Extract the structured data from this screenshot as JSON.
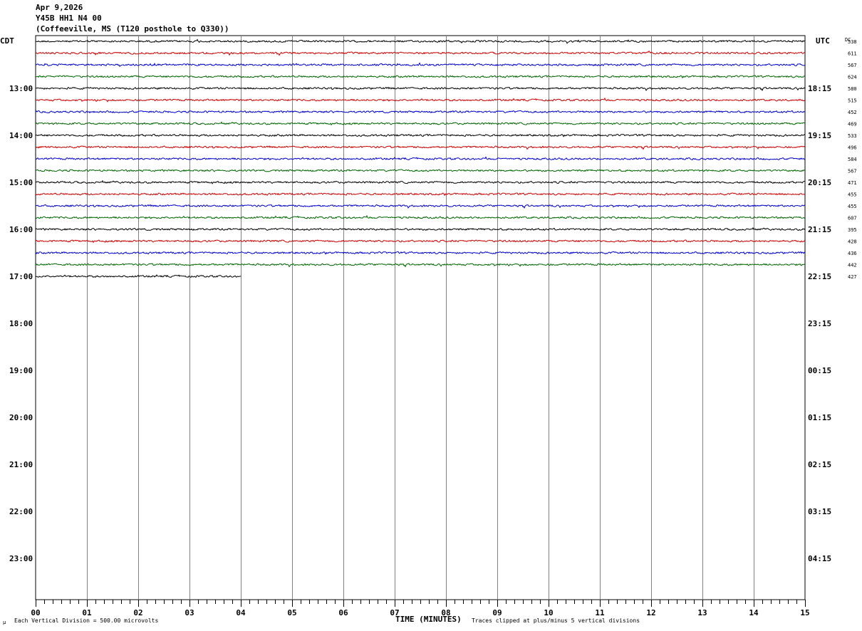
{
  "header": {
    "date": "Apr 9,2026",
    "station": "Y45B HH1 N4 00",
    "location": "(Coffeeville, MS (T120 posthole to Q330))"
  },
  "left_axis_label": "CDT",
  "right_axis_label": "UTC",
  "dc_label": "DC",
  "footer": {
    "scale_note": "Each Vertical Division =  500.00 microvolts",
    "xlabel": "TIME (MINUTES)",
    "clip_note": "Traces clipped at plus/minus 5 vertical divisions"
  },
  "chart_data": {
    "type": "line",
    "title": "",
    "xlabel": "TIME (MINUTES)",
    "xlim": [
      0,
      15
    ],
    "x_ticks": [
      "00",
      "01",
      "02",
      "03",
      "04",
      "05",
      "06",
      "07",
      "08",
      "09",
      "10",
      "11",
      "12",
      "13",
      "14",
      "15"
    ],
    "rows_per_hour": 4,
    "first_row_cdt": "12:00",
    "hour_labels_cdt": [
      "13:00",
      "14:00",
      "15:00",
      "16:00",
      "17:00",
      "18:00",
      "19:00",
      "20:00",
      "21:00",
      "22:00",
      "23:00"
    ],
    "hour_labels_utc": [
      "18:15",
      "19:15",
      "20:15",
      "21:15",
      "22:15",
      "23:15",
      "00:15",
      "01:15",
      "02:15",
      "03:15",
      "04:15"
    ],
    "trace_colors": [
      "#000000",
      "#cc0000",
      "#0000cc",
      "#006600"
    ],
    "dc_offsets": [
      "538",
      "611",
      "567",
      "624",
      "580",
      "515",
      "452",
      "469",
      "533",
      "496",
      "584",
      "567",
      "471",
      "455",
      "455",
      "607",
      "395",
      "428",
      "436",
      "442",
      "427"
    ],
    "trace_end_minutes": [
      15,
      15,
      15,
      15,
      15,
      15,
      15,
      15,
      15,
      15,
      15,
      15,
      15,
      15,
      15,
      15,
      15,
      15,
      15,
      15,
      4
    ]
  }
}
